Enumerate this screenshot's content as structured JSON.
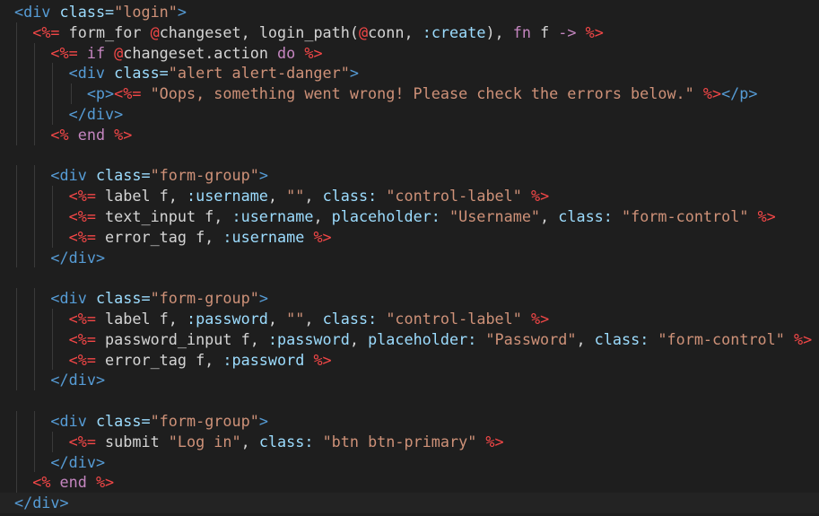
{
  "editor": {
    "lines": [
      {
        "indent": 0,
        "tokens": [
          [
            "tag",
            "<div "
          ],
          [
            "attr",
            "class="
          ],
          [
            "str",
            "\"login\""
          ],
          [
            "tag",
            ">"
          ]
        ]
      },
      {
        "indent": 1,
        "tokens": [
          [
            "eex",
            "<%= "
          ],
          [
            "text",
            "form_for "
          ],
          [
            "ivar",
            "@"
          ],
          [
            "ivar-name",
            "changeset"
          ],
          [
            "text",
            ", login_path("
          ],
          [
            "ivar",
            "@"
          ],
          [
            "ivar-name",
            "conn"
          ],
          [
            "text",
            ", "
          ],
          [
            "sym",
            ":create"
          ],
          [
            "text",
            "), "
          ],
          [
            "kw",
            "fn "
          ],
          [
            "text",
            "f "
          ],
          [
            "kw",
            "-> "
          ],
          [
            "eex",
            "%>"
          ]
        ]
      },
      {
        "indent": 2,
        "tokens": [
          [
            "eex",
            "<%= "
          ],
          [
            "kw",
            "if "
          ],
          [
            "ivar",
            "@"
          ],
          [
            "ivar-name",
            "changeset"
          ],
          [
            "text",
            ".action "
          ],
          [
            "kw",
            "do "
          ],
          [
            "eex",
            "%>"
          ]
        ]
      },
      {
        "indent": 3,
        "tokens": [
          [
            "tag",
            "<div "
          ],
          [
            "attr",
            "class="
          ],
          [
            "str",
            "\"alert alert-danger\""
          ],
          [
            "tag",
            ">"
          ]
        ]
      },
      {
        "indent": 4,
        "tokens": [
          [
            "tag",
            "<p>"
          ],
          [
            "eex",
            "<%= "
          ],
          [
            "str",
            "\"Oops, something went wrong! Please check the errors below.\" "
          ],
          [
            "eex",
            "%>"
          ],
          [
            "tag",
            "</p>"
          ]
        ]
      },
      {
        "indent": 3,
        "tokens": [
          [
            "tag",
            "</div>"
          ]
        ]
      },
      {
        "indent": 2,
        "tokens": [
          [
            "eex",
            "<% "
          ],
          [
            "kw",
            "end "
          ],
          [
            "eex",
            "%>"
          ]
        ]
      },
      {
        "indent": 0,
        "tokens": []
      },
      {
        "indent": 2,
        "tokens": [
          [
            "tag",
            "<div "
          ],
          [
            "attr",
            "class="
          ],
          [
            "str",
            "\"form-group\""
          ],
          [
            "tag",
            ">"
          ]
        ]
      },
      {
        "indent": 3,
        "tokens": [
          [
            "eex",
            "<%= "
          ],
          [
            "text",
            "label f, "
          ],
          [
            "sym",
            ":username"
          ],
          [
            "text",
            ", "
          ],
          [
            "str",
            "\"\""
          ],
          [
            "text",
            ", "
          ],
          [
            "sym",
            "class: "
          ],
          [
            "str",
            "\"control-label\" "
          ],
          [
            "eex",
            "%>"
          ]
        ]
      },
      {
        "indent": 3,
        "tokens": [
          [
            "eex",
            "<%= "
          ],
          [
            "text",
            "text_input f, "
          ],
          [
            "sym",
            ":username"
          ],
          [
            "text",
            ", "
          ],
          [
            "sym",
            "placeholder: "
          ],
          [
            "str",
            "\"Username\""
          ],
          [
            "text",
            ", "
          ],
          [
            "sym",
            "class: "
          ],
          [
            "str",
            "\"form-control\" "
          ],
          [
            "eex",
            "%>"
          ]
        ]
      },
      {
        "indent": 3,
        "tokens": [
          [
            "eex",
            "<%= "
          ],
          [
            "text",
            "error_tag f, "
          ],
          [
            "sym",
            ":username "
          ],
          [
            "eex",
            "%>"
          ]
        ]
      },
      {
        "indent": 2,
        "tokens": [
          [
            "tag",
            "</div>"
          ]
        ]
      },
      {
        "indent": 0,
        "tokens": []
      },
      {
        "indent": 2,
        "tokens": [
          [
            "tag",
            "<div "
          ],
          [
            "attr",
            "class="
          ],
          [
            "str",
            "\"form-group\""
          ],
          [
            "tag",
            ">"
          ]
        ]
      },
      {
        "indent": 3,
        "tokens": [
          [
            "eex",
            "<%= "
          ],
          [
            "text",
            "label f, "
          ],
          [
            "sym",
            ":password"
          ],
          [
            "text",
            ", "
          ],
          [
            "str",
            "\"\""
          ],
          [
            "text",
            ", "
          ],
          [
            "sym",
            "class: "
          ],
          [
            "str",
            "\"control-label\" "
          ],
          [
            "eex",
            "%>"
          ]
        ]
      },
      {
        "indent": 3,
        "tokens": [
          [
            "eex",
            "<%= "
          ],
          [
            "text",
            "password_input f, "
          ],
          [
            "sym",
            ":password"
          ],
          [
            "text",
            ", "
          ],
          [
            "sym",
            "placeholder: "
          ],
          [
            "str",
            "\"Password\""
          ],
          [
            "text",
            ", "
          ],
          [
            "sym",
            "class: "
          ],
          [
            "str",
            "\"form-control\" "
          ],
          [
            "eex",
            "%>"
          ]
        ]
      },
      {
        "indent": 3,
        "tokens": [
          [
            "eex",
            "<%= "
          ],
          [
            "text",
            "error_tag f, "
          ],
          [
            "sym",
            ":password "
          ],
          [
            "eex",
            "%>"
          ]
        ]
      },
      {
        "indent": 2,
        "tokens": [
          [
            "tag",
            "</div>"
          ]
        ]
      },
      {
        "indent": 0,
        "tokens": []
      },
      {
        "indent": 2,
        "tokens": [
          [
            "tag",
            "<div "
          ],
          [
            "attr",
            "class="
          ],
          [
            "str",
            "\"form-group\""
          ],
          [
            "tag",
            ">"
          ]
        ]
      },
      {
        "indent": 3,
        "tokens": [
          [
            "eex",
            "<%= "
          ],
          [
            "text",
            "submit "
          ],
          [
            "str",
            "\"Log in\""
          ],
          [
            "text",
            ", "
          ],
          [
            "sym",
            "class: "
          ],
          [
            "str",
            "\"btn btn-primary\" "
          ],
          [
            "eex",
            "%>"
          ]
        ]
      },
      {
        "indent": 2,
        "tokens": [
          [
            "tag",
            "</div>"
          ]
        ]
      },
      {
        "indent": 1,
        "tokens": [
          [
            "eex",
            "<% "
          ],
          [
            "kw",
            "end "
          ],
          [
            "eex",
            "%>"
          ]
        ]
      },
      {
        "indent": 0,
        "tokens": [
          [
            "tag",
            "</div>"
          ]
        ]
      }
    ],
    "active_line": 24
  }
}
